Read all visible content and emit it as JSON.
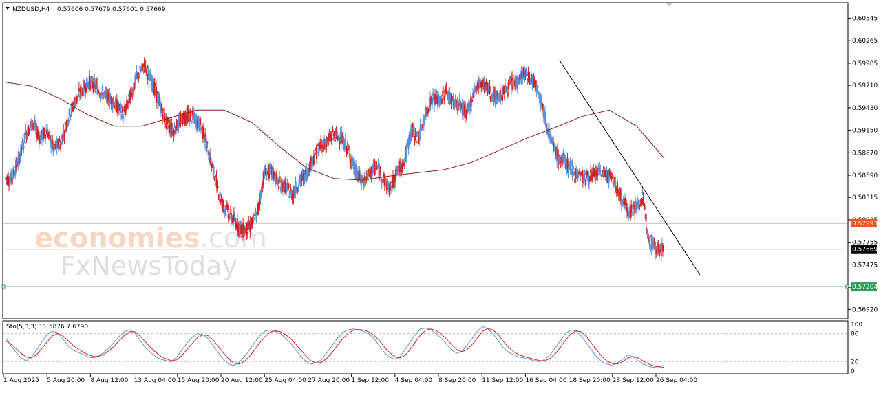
{
  "header": {
    "symbol": "NZDUSD,H4",
    "ohlc": "0.57606 0.57679 0.57601 0.57669"
  },
  "stochastic": {
    "label": "Sto(5,3,3) 11.5876 7.6790",
    "levels": [
      "100",
      "80",
      "20",
      "0"
    ],
    "main_values": [
      72,
      55,
      40,
      28,
      22,
      30,
      45,
      62,
      78,
      85,
      82,
      70,
      55,
      45,
      40,
      35,
      30,
      28,
      33,
      40,
      50,
      62,
      75,
      85,
      88,
      80,
      65,
      50,
      40,
      30,
      25,
      22,
      20,
      30,
      45,
      60,
      72,
      80,
      78,
      70,
      55,
      40,
      25,
      15,
      12,
      18,
      30,
      45,
      60,
      75,
      85,
      88,
      85,
      80,
      70,
      60,
      45,
      30,
      20,
      15,
      18,
      25,
      40,
      55,
      70,
      82,
      88,
      90,
      88,
      85,
      80,
      70,
      55,
      40,
      30,
      25,
      30,
      45,
      62,
      78,
      90,
      92,
      88,
      80,
      70,
      58,
      45,
      38,
      42,
      55,
      70,
      85,
      95,
      90,
      80,
      65,
      50,
      40,
      35,
      30,
      28,
      25,
      22,
      20,
      25,
      35,
      50,
      65,
      80,
      88,
      85,
      75,
      60,
      45,
      30,
      20,
      15,
      12,
      18,
      25,
      35,
      30,
      22,
      15,
      10,
      8,
      10,
      12
    ],
    "signal_values": [
      65,
      58,
      48,
      38,
      30,
      28,
      35,
      48,
      62,
      75,
      80,
      76,
      66,
      55,
      47,
      40,
      35,
      31,
      31,
      36,
      44,
      54,
      66,
      77,
      84,
      84,
      74,
      62,
      50,
      40,
      31,
      26,
      22,
      24,
      33,
      46,
      59,
      71,
      77,
      76,
      67,
      53,
      39,
      26,
      17,
      15,
      20,
      31,
      45,
      60,
      73,
      83,
      86,
      84,
      78,
      69,
      57,
      44,
      31,
      21,
      17,
      19,
      28,
      40,
      55,
      69,
      80,
      87,
      89,
      88,
      84,
      77,
      66,
      52,
      40,
      31,
      28,
      33,
      46,
      62,
      77,
      87,
      90,
      87,
      79,
      69,
      57,
      46,
      41,
      46,
      57,
      71,
      85,
      91,
      88,
      78,
      63,
      51,
      41,
      35,
      31,
      28,
      25,
      22,
      22,
      27,
      37,
      51,
      66,
      79,
      86,
      84,
      74,
      59,
      45,
      31,
      21,
      16,
      15,
      20,
      28,
      31,
      28,
      21,
      15,
      11,
      9,
      8
    ]
  },
  "price_axis": {
    "ticks": [
      "0.60545",
      "0.60265",
      "0.59985",
      "0.59710",
      "0.59430",
      "0.59150",
      "0.58870",
      "0.58590",
      "0.58315",
      "0.58035",
      "0.57755",
      "0.57475",
      "0.57195",
      "0.56920"
    ],
    "current_price": "0.57669",
    "resistance_line": "0.57993",
    "support_line": "0.57204",
    "colors": {
      "bull": "#5b8fd6",
      "bear": "#d12323",
      "ma": "#8b1a1a",
      "resistance": "#f0561e",
      "support": "#2c9b5a",
      "current": "#000000"
    }
  },
  "time_axis": {
    "labels": [
      "1 Aug 2025",
      "5 Aug 20:00",
      "8 Aug 12:00",
      "13 Aug 04:00",
      "15 Aug 20:00",
      "20 Aug 12:00",
      "25 Aug 04:00",
      "27 Aug 20:00",
      "1 Sep 12:00",
      "4 Sep 04:00",
      "8 Sep 20:00",
      "11 Sep 12:00",
      "16 Sep 04:00",
      "18 Sep 20:00",
      "23 Sep 12:00",
      "26 Sep 04:00"
    ]
  },
  "chart_data": {
    "type": "candlestick",
    "symbol": "NZDUSD",
    "timeframe": "H4",
    "ylim": [
      0.5682,
      0.6072
    ],
    "close_series": [
      0.5855,
      0.588,
      0.591,
      0.5925,
      0.5905,
      0.5915,
      0.589,
      0.59,
      0.593,
      0.595,
      0.5965,
      0.5975,
      0.597,
      0.596,
      0.5955,
      0.5945,
      0.5935,
      0.596,
      0.5985,
      0.5995,
      0.5975,
      0.595,
      0.5925,
      0.5915,
      0.5925,
      0.5935,
      0.593,
      0.592,
      0.589,
      0.5855,
      0.5825,
      0.581,
      0.58,
      0.579,
      0.5795,
      0.581,
      0.586,
      0.5865,
      0.585,
      0.5845,
      0.5835,
      0.585,
      0.586,
      0.588,
      0.5895,
      0.59,
      0.591,
      0.5905,
      0.589,
      0.5865,
      0.585,
      0.586,
      0.587,
      0.5855,
      0.584,
      0.5865,
      0.5875,
      0.5915,
      0.5905,
      0.5935,
      0.5955,
      0.595,
      0.5965,
      0.595,
      0.5945,
      0.5935,
      0.5965,
      0.5975,
      0.5965,
      0.5955,
      0.596,
      0.597,
      0.5975,
      0.5985,
      0.598,
      0.597,
      0.5935,
      0.59,
      0.588,
      0.5875,
      0.5865,
      0.586,
      0.5855,
      0.586,
      0.5862,
      0.586,
      0.585,
      0.583,
      0.5815,
      0.5818,
      0.583,
      0.578,
      0.5768,
      0.5767
    ],
    "moving_average": [
      0.5975,
      0.597,
      0.5955,
      0.5935,
      0.592,
      0.592,
      0.593,
      0.594,
      0.594,
      0.5925,
      0.5895,
      0.5868,
      0.5855,
      0.5853,
      0.5858,
      0.5862,
      0.5866,
      0.5875,
      0.589,
      0.5905,
      0.5918,
      0.5932,
      0.594,
      0.592,
      0.588
    ],
    "trendline": {
      "from": [
        "16 Sep 04:00",
        0.6002
      ],
      "to": [
        "26 Sep 12:00",
        0.5735
      ]
    },
    "horizontal_lines": [
      0.57993,
      0.57669,
      0.57204
    ]
  }
}
